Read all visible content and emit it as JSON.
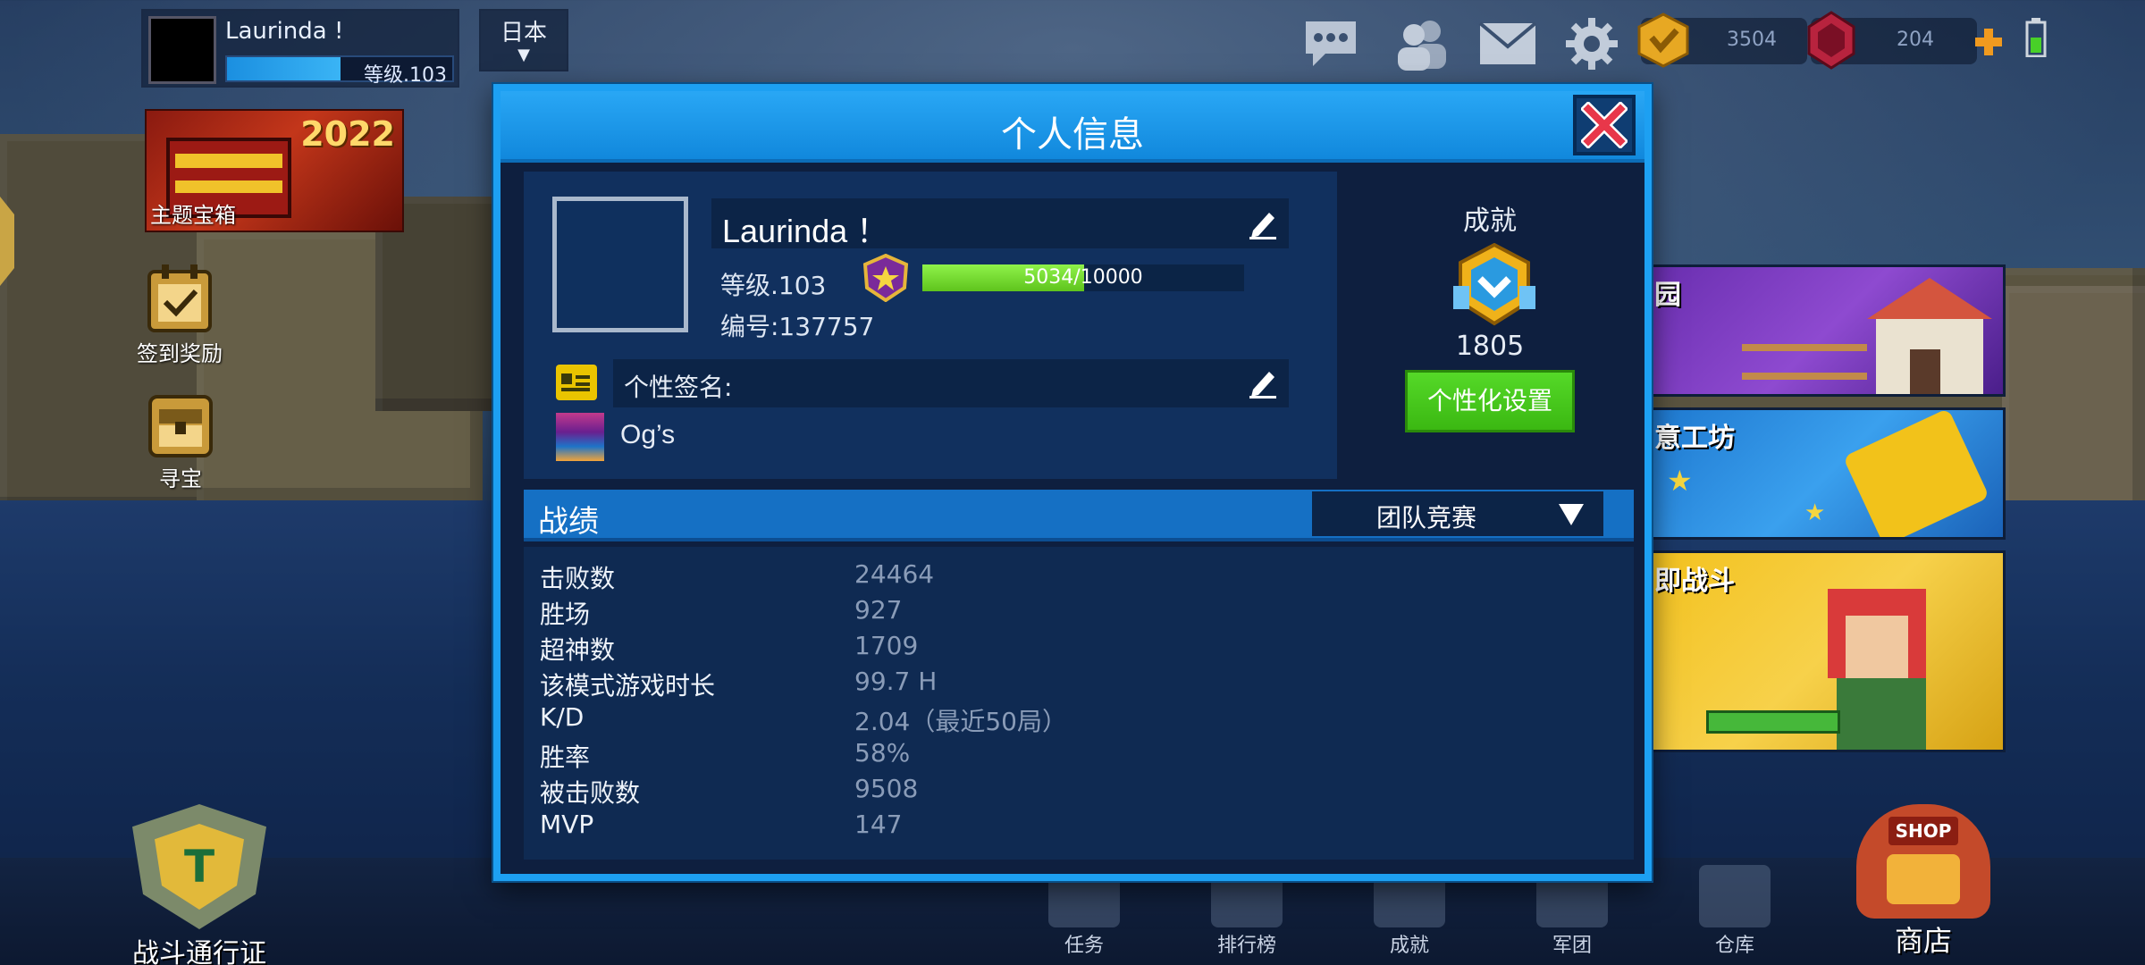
{
  "hud": {
    "player_name": "Laurinda !",
    "level_text": "等级.103",
    "level_progress": 0.5034,
    "region": "日本",
    "coins": "3504",
    "gems": "204"
  },
  "side_menu": {
    "theme_chest_year": "2022",
    "theme_chest_label": "主题宝箱",
    "checkin_label": "签到奖励",
    "treasure_label": "寻宝"
  },
  "right_cards": [
    {
      "title": "园",
      "color": "#7a3fc0"
    },
    {
      "title": "意工坊",
      "color": "#2a8de0"
    },
    {
      "title": "即战斗",
      "color": "#e6b21a"
    }
  ],
  "bottom_nav": {
    "pass_label": "战斗通行证",
    "items": [
      "任务",
      "排行榜",
      "成就",
      "军团",
      "仓库"
    ],
    "shop_tag": "SHOP",
    "shop_label": "商店"
  },
  "modal": {
    "title": "个人信息",
    "name": "Laurinda ！",
    "level": "等级.103",
    "xp_text": "5034/10000",
    "xp_progress": 0.5034,
    "id": "编号:137757",
    "signature_label": "个性签名:",
    "clan_name": "Og’s",
    "achievement_title": "成就",
    "achievement_value": "1805",
    "customize_button": "个性化设置",
    "stats_title": "战绩",
    "mode": "团队竞赛",
    "stats": [
      {
        "label": "击败数",
        "value": "24464"
      },
      {
        "label": "胜场",
        "value": "927"
      },
      {
        "label": "超神数",
        "value": "1709"
      },
      {
        "label": "该模式游戏时长",
        "value": "99.7 H"
      },
      {
        "label": "K/D",
        "value": "2.04（最近50局）"
      },
      {
        "label": "胜率",
        "value": "58%"
      },
      {
        "label": "被击败数",
        "value": "9508"
      },
      {
        "label": "MVP",
        "value": "147"
      }
    ]
  },
  "colors": {
    "accent_blue": "#1da0f2",
    "green_button": "#3bb812",
    "xp_green": "#7ee23a",
    "close_red": "#e8374a"
  }
}
